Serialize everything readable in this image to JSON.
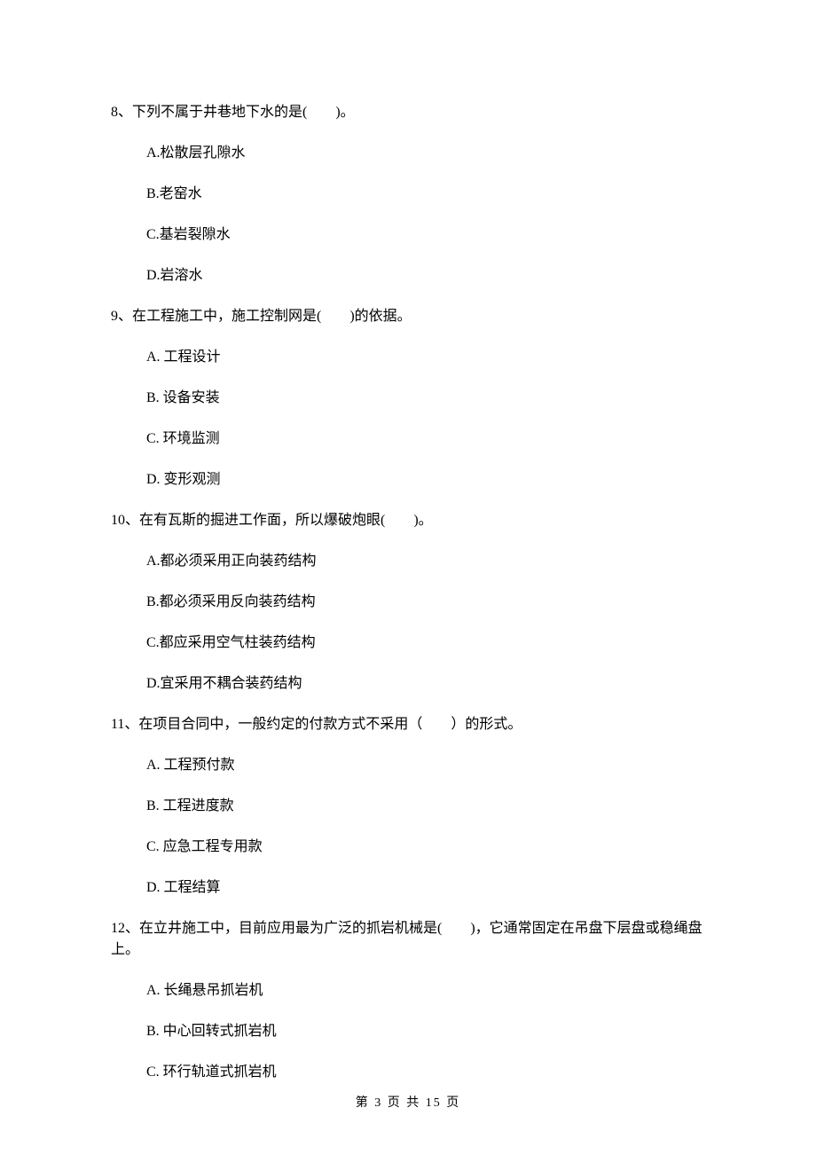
{
  "questions": [
    {
      "number": "8",
      "text": "8、下列不属于井巷地下水的是(　　)。",
      "options": [
        "A.松散层孔隙水",
        "B.老窑水",
        "C.基岩裂隙水",
        "D.岩溶水"
      ]
    },
    {
      "number": "9",
      "text": "9、在工程施工中，施工控制网是(　　)的依据。",
      "options": [
        "A. 工程设计",
        "B. 设备安装",
        "C. 环境监测",
        "D. 变形观测"
      ]
    },
    {
      "number": "10",
      "text": "10、在有瓦斯的掘进工作面，所以爆破炮眼(　　)。",
      "options": [
        "A.都必须采用正向装药结构",
        "B.都必须采用反向装药结构",
        "C.都应采用空气柱装药结构",
        "D.宜采用不耦合装药结构"
      ]
    },
    {
      "number": "11",
      "text": "11、在项目合同中，一般约定的付款方式不采用（　　）的形式。",
      "options": [
        "A. 工程预付款",
        "B. 工程进度款",
        "C. 应急工程专用款",
        "D. 工程结算"
      ]
    },
    {
      "number": "12",
      "text": "12、在立井施工中，目前应用最为广泛的抓岩机械是(　　)，它通常固定在吊盘下层盘或稳绳盘上。",
      "options": [
        "A. 长绳悬吊抓岩机",
        "B. 中心回转式抓岩机",
        "C. 环行轨道式抓岩机"
      ]
    }
  ],
  "footer": {
    "text": "第 3 页 共 15 页"
  }
}
